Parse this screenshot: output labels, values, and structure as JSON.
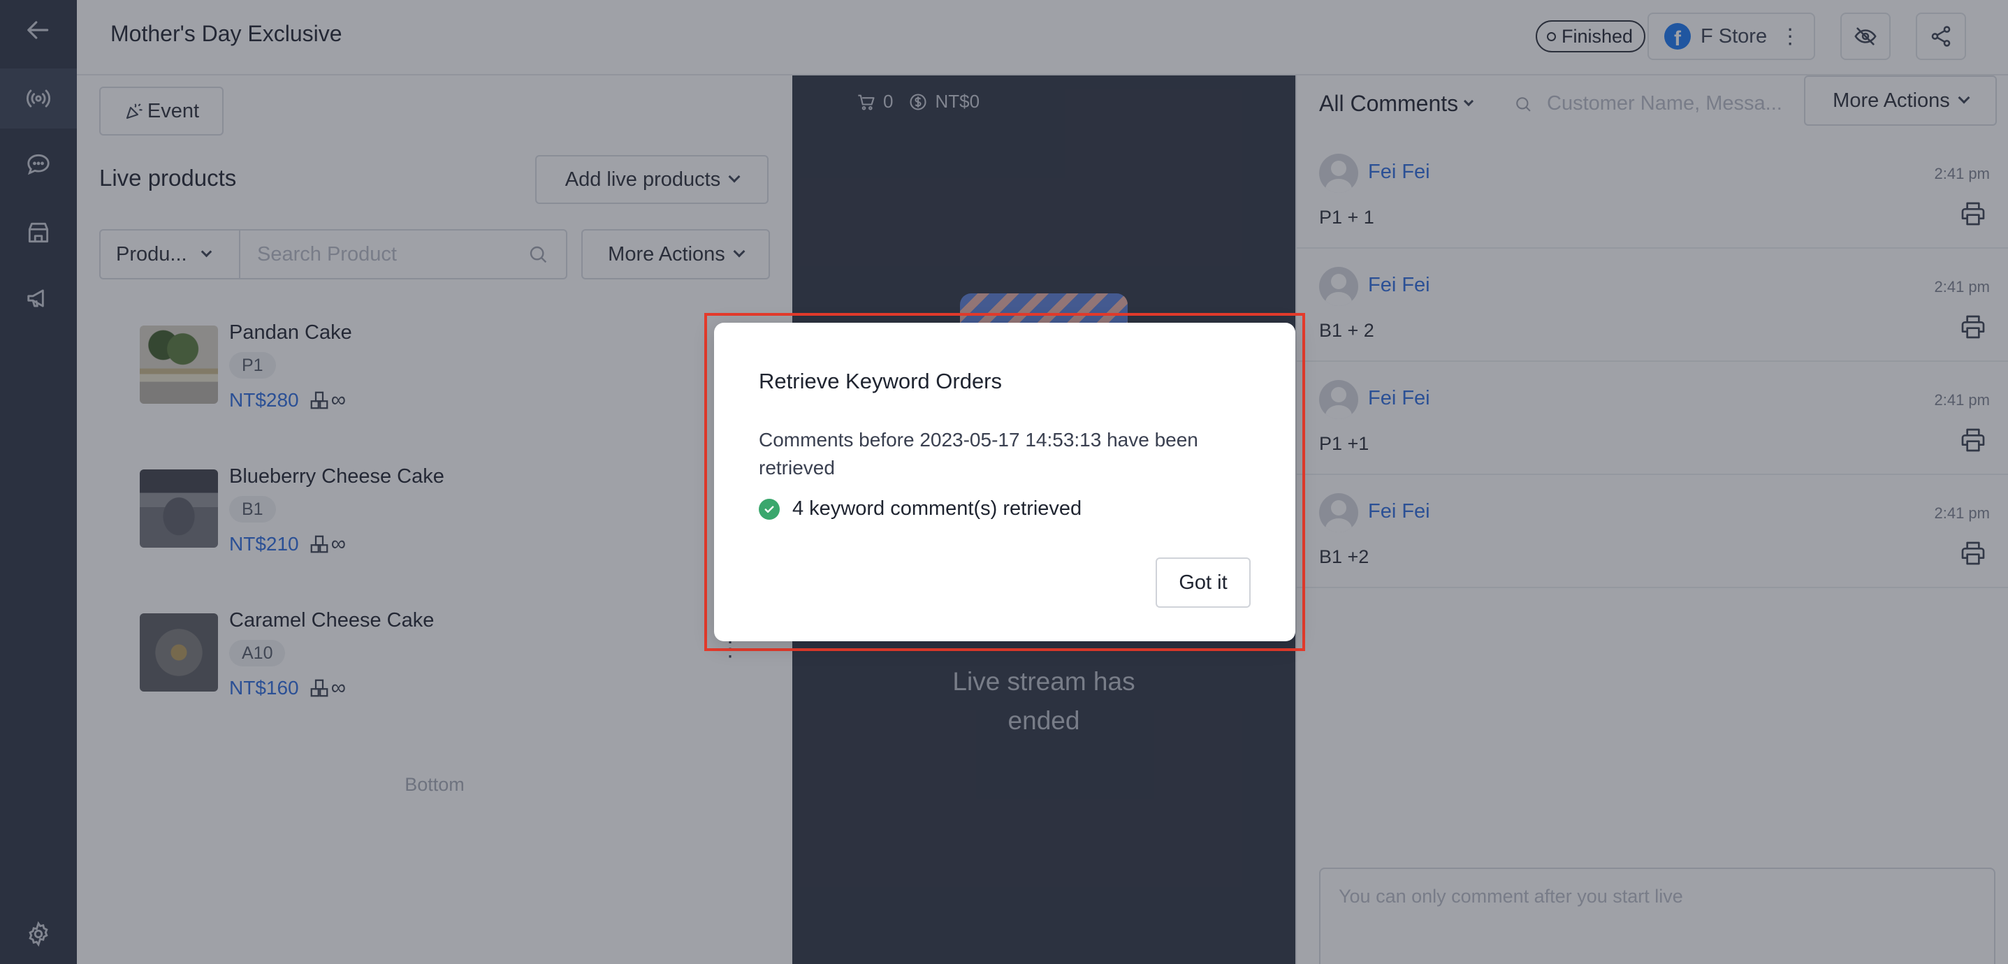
{
  "header": {
    "title": "Mother's Day Exclusive",
    "status": "Finished",
    "store_name": "F Store"
  },
  "rail": {
    "icons": [
      "back-arrow-icon",
      "live-broadcast-icon",
      "chat-bubble-icon",
      "store-icon",
      "megaphone-icon",
      "gear-icon"
    ]
  },
  "products_panel": {
    "event_label": "Event",
    "title": "Live products",
    "add_label": "Add live products",
    "filter_label": "Produ...",
    "search_placeholder": "Search Product",
    "more_actions_label": "More Actions",
    "items": [
      {
        "name": "Pandan Cake",
        "code": "P1",
        "price": "NT$280",
        "stock": "∞"
      },
      {
        "name": "Blueberry Cheese Cake",
        "code": "B1",
        "price": "NT$210",
        "stock": "∞"
      },
      {
        "name": "Caramel Cheese Cake",
        "code": "A10",
        "price": "NT$160",
        "stock": "∞"
      }
    ],
    "bottom_label": "Bottom"
  },
  "video": {
    "cart_count": "0",
    "revenue": "NT$0",
    "ended_line1": "Live stream has",
    "ended_line2": "ended"
  },
  "comments_panel": {
    "filter_label": "All Comments",
    "search_placeholder": "Customer Name, Messa...",
    "more_actions_label": "More Actions",
    "items": [
      {
        "name": "Fei Fei",
        "time": "2:41 pm",
        "text": "P1 + 1"
      },
      {
        "name": "Fei Fei",
        "time": "2:41 pm",
        "text": "B1 + 2"
      },
      {
        "name": "Fei Fei",
        "time": "2:41 pm",
        "text": "P1 +1"
      },
      {
        "name": "Fei Fei",
        "time": "2:41 pm",
        "text": "B1 +2"
      }
    ],
    "input_placeholder": "You can only comment after you start live"
  },
  "modal": {
    "title": "Retrieve Keyword Orders",
    "body": "Comments before 2023-05-17 14:53:13 have been retrieved",
    "result": "4 keyword comment(s) retrieved",
    "confirm_label": "Got it"
  },
  "colors": {
    "accent": "#2d6cdf",
    "success": "#3aa76d",
    "highlight": "#e53b2c",
    "rail": "#2c3344"
  }
}
